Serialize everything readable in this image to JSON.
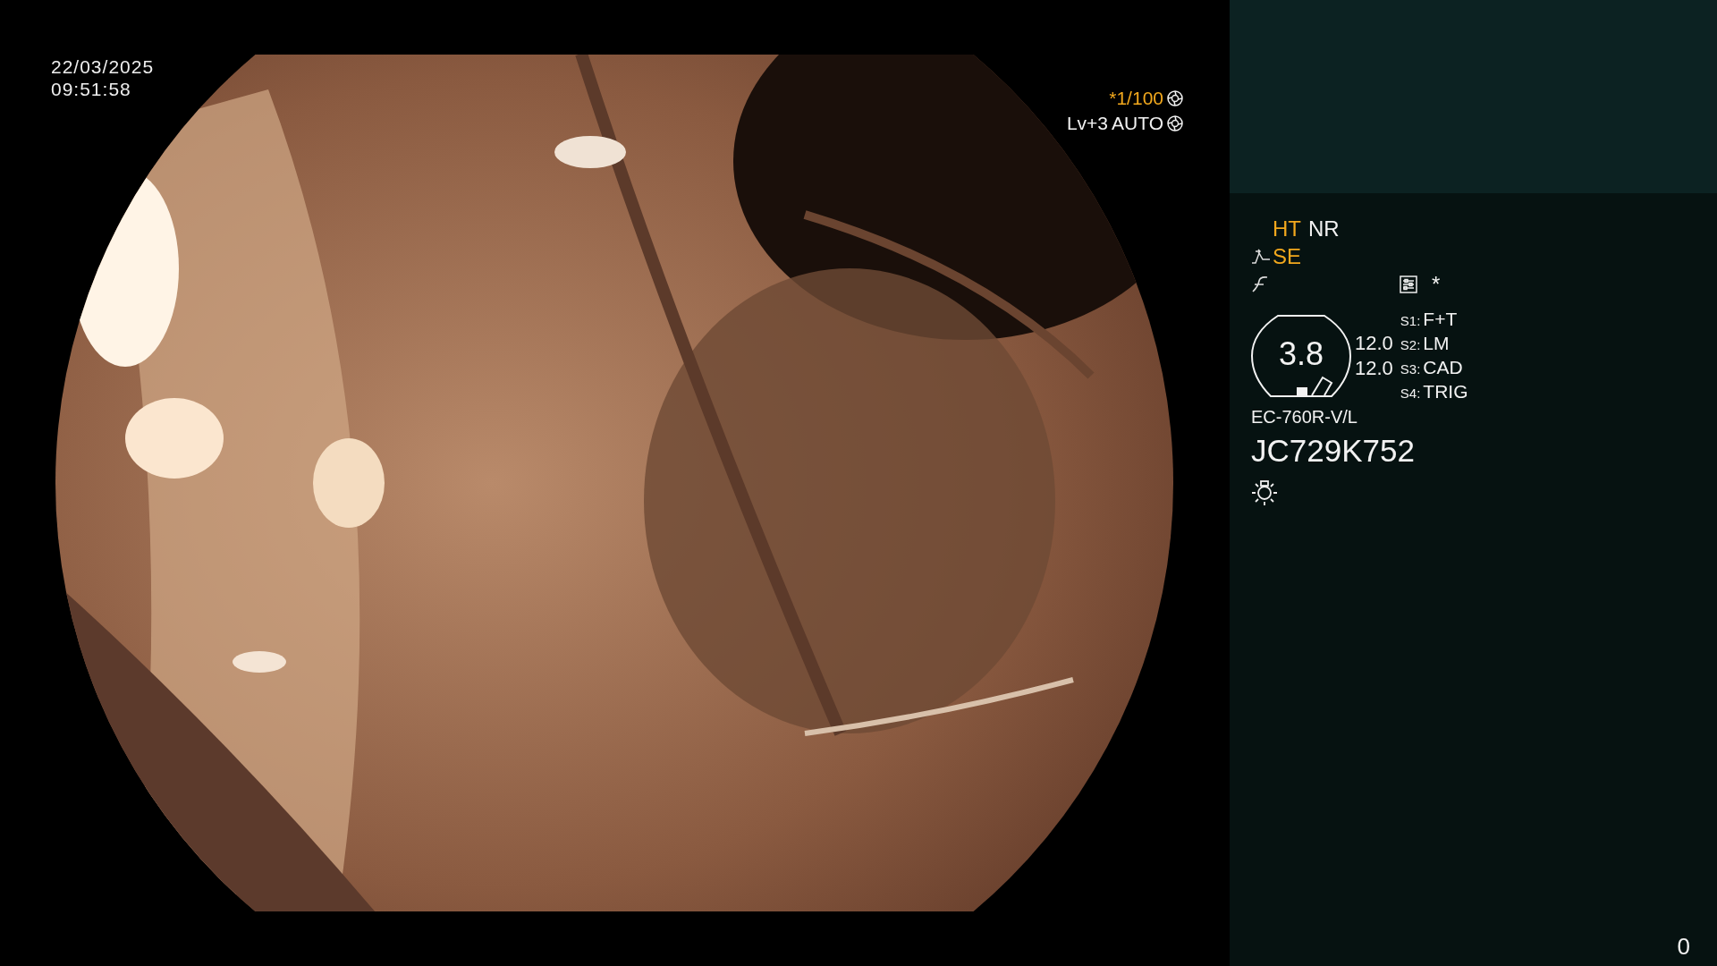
{
  "datetime": {
    "date": "22/03/2025",
    "time": "09:51:58"
  },
  "exposure": {
    "shutter": {
      "label": "*1/100",
      "active": true
    },
    "level": "Lv+3",
    "mode": "AUTO"
  },
  "panel": {
    "modes": [
      {
        "label": "HT",
        "active": true
      },
      {
        "label": "NR",
        "active": false
      }
    ],
    "enhance": {
      "label": "SE",
      "active": true
    },
    "star": "*",
    "zoom": "3.8",
    "readings": [
      "12.0",
      "12.0"
    ],
    "switches": [
      {
        "key": "S1:",
        "value": "F+T"
      },
      {
        "key": "S2:",
        "value": "LM"
      },
      {
        "key": "S3:",
        "value": "CAD"
      },
      {
        "key": "S4:",
        "value": "TRIG"
      }
    ],
    "model": "EC-760R-V/L",
    "serial": "JC729K752"
  },
  "counter": "0"
}
